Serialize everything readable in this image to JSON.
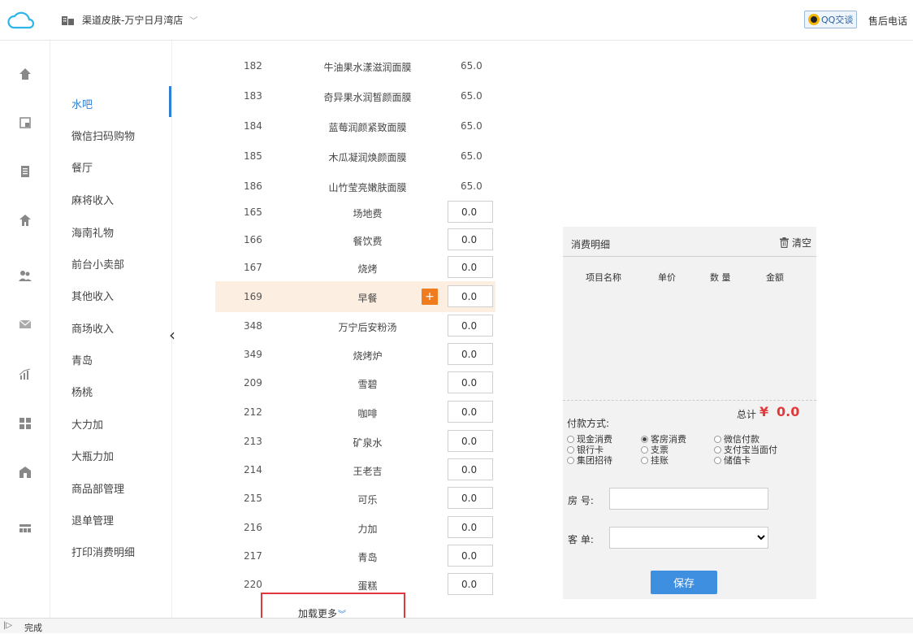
{
  "header": {
    "store_name": "渠道皮肤-万宁日月湾店",
    "store_chevron": "﹀",
    "qq_label": "QQ交谈",
    "hotline_label": "售后电话"
  },
  "rail": {
    "icons": [
      "home-icon",
      "report-icon",
      "document-icon",
      "store-icon",
      "users-icon",
      "mail-icon",
      "chart-icon",
      "grid-icon",
      "building-icon",
      "list-icon"
    ]
  },
  "menu": {
    "active_index": 0,
    "items": [
      "水吧",
      "微信扫码购物",
      "餐厅",
      "麻将收入",
      "海南礼物",
      "前台小卖部",
      "其他收入",
      "商场收入",
      "青岛",
      "杨桃",
      "大力加",
      "大瓶力加",
      "商品部管理",
      "退单管理",
      "打印消费明细"
    ],
    "collapse_glyph": "‹"
  },
  "products": [
    {
      "code": "182",
      "name": "牛油果水漾滋润面膜",
      "price": "65.0"
    },
    {
      "code": "183",
      "name": "奇异果水润皙颜面膜",
      "price": "65.0"
    },
    {
      "code": "184",
      "name": "蓝莓润颜紧致面膜",
      "price": "65.0"
    },
    {
      "code": "185",
      "name": "木瓜凝润焕颜面膜",
      "price": "65.0"
    },
    {
      "code": "186",
      "name": "山竹莹亮嫩肤面膜",
      "price": "65.0"
    },
    {
      "code": "165",
      "name": "场地费",
      "qty": "0.0"
    },
    {
      "code": "166",
      "name": "餐饮费",
      "qty": "0.0"
    },
    {
      "code": "167",
      "name": "烧烤",
      "qty": "0.0"
    },
    {
      "code": "169",
      "name": "早餐",
      "qty": "0.0",
      "highlighted": true,
      "plus": "+"
    },
    {
      "code": "348",
      "name": "万宁后安粉汤",
      "qty": "0.0"
    },
    {
      "code": "349",
      "name": "烧烤炉",
      "qty": "0.0"
    },
    {
      "code": "209",
      "name": "雪碧",
      "qty": "0.0"
    },
    {
      "code": "212",
      "name": "咖啡",
      "qty": "0.0"
    },
    {
      "code": "213",
      "name": "矿泉水",
      "qty": "0.0"
    },
    {
      "code": "214",
      "name": "王老吉",
      "qty": "0.0"
    },
    {
      "code": "215",
      "name": "可乐",
      "qty": "0.0"
    },
    {
      "code": "216",
      "name": "力加",
      "qty": "0.0"
    },
    {
      "code": "217",
      "name": "青岛",
      "qty": "0.0"
    },
    {
      "code": "220",
      "name": "蛋糕",
      "qty": "0.0"
    }
  ],
  "load_more": {
    "label": "加载更多",
    "glyph": "︾"
  },
  "panel": {
    "title": "消费明细",
    "clear_label": "清空",
    "columns": [
      "项目名称",
      "单价",
      "数 量",
      "金额"
    ],
    "total_label": "总计",
    "currency": "¥",
    "total_value": "0.0",
    "payment_label": "付款方式:",
    "payment_options": [
      {
        "label": "现金消费",
        "checked": false
      },
      {
        "label": "客房消费",
        "checked": true
      },
      {
        "label": "微信付款",
        "checked": false
      },
      {
        "label": "银行卡",
        "checked": false
      },
      {
        "label": "支票",
        "checked": false
      },
      {
        "label": "支付宝当面付",
        "checked": false
      },
      {
        "label": "集团招待",
        "checked": false
      },
      {
        "label": "挂账",
        "checked": false
      },
      {
        "label": "储值卡",
        "checked": false
      }
    ],
    "room_label": "房  号:",
    "room_value": "",
    "guest_label": "客  单:",
    "guest_selected": "",
    "save_label": "保存"
  },
  "status": {
    "text": "完成"
  },
  "colors": {
    "accent": "#2f7fd4",
    "highlight_row": "#fdeee2",
    "plus_button": "#ef7d1f",
    "total": "#e23a3a",
    "annotation_box": "#e0383e"
  }
}
